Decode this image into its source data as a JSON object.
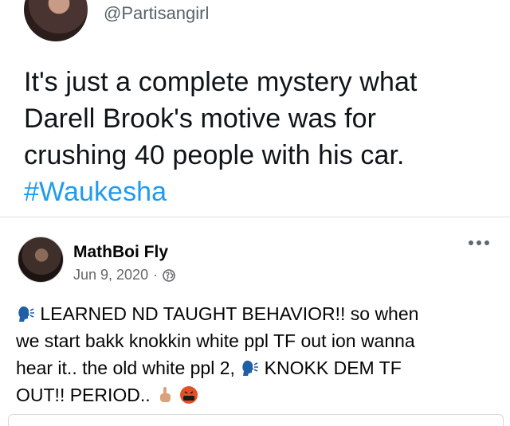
{
  "tweet": {
    "handle": "@Partisangirl",
    "text_lines": [
      "It's just a complete mystery what",
      "Darell Brook's motive was for",
      "crushing 40 people with his car."
    ],
    "hashtag": "#Waukesha",
    "colors": {
      "text": "#0f1419",
      "hashtag": "#1d9bf0",
      "handle": "#56626c"
    }
  },
  "post": {
    "author": "MathBoi Fly",
    "date": "Jun 9, 2020",
    "separator": "·",
    "privacy_icon": "globe-icon",
    "more_icon": "more-options-icon",
    "text_parts": {
      "p1": "LEARNED ND TAUGHT BEHAVIOR!! so when",
      "p2": "we start bakk knokkin white ppl TF out ion wanna",
      "p3": "hear it.. the old white ppl 2,",
      "p4": "KNOKK DEM TF",
      "p5": "OUT!! PERIOD.."
    },
    "emoji_icons": [
      "speaking-head-icon",
      "speaking-head-icon",
      "middle-finger-icon",
      "cursing-face-icon"
    ]
  }
}
